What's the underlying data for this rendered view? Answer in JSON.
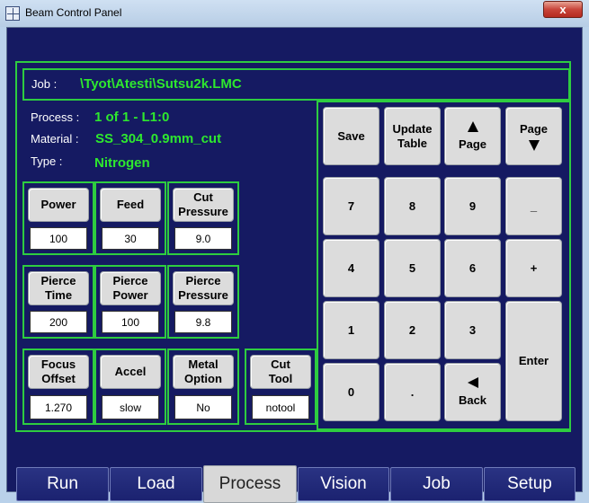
{
  "window": {
    "title": "Beam Control Panel",
    "close_glyph": "x"
  },
  "job": {
    "label": "Job :",
    "value": "\\Tyot\\Atesti\\Sutsu2k.LMC"
  },
  "info": {
    "process_label": "Process :",
    "process_value": "1 of 1 - L1:0",
    "material_label": "Material :",
    "material_value": "SS_304_0.9mm_cut",
    "type_label": "Type :",
    "type_value": "Nitrogen"
  },
  "params": {
    "power": {
      "label": "Power",
      "value": "100"
    },
    "feed": {
      "label": "Feed",
      "value": "30"
    },
    "cut_pressure": {
      "label_1": "Cut",
      "label_2": "Pressure",
      "value": "9.0"
    },
    "pierce_time": {
      "label_1": "Pierce",
      "label_2": "Time",
      "value": "200"
    },
    "pierce_power": {
      "label_1": "Pierce",
      "label_2": "Power",
      "value": "100"
    },
    "pierce_pressure": {
      "label_1": "Pierce",
      "label_2": "Pressure",
      "value": "9.8"
    },
    "focus_offset": {
      "label_1": "Focus",
      "label_2": "Offset",
      "value": "1.270"
    },
    "accel": {
      "label": "Accel",
      "value": "slow"
    },
    "metal_option": {
      "label_1": "Metal",
      "label_2": "Option",
      "value": "No"
    },
    "cut_tool": {
      "label_1": "Cut",
      "label_2": "Tool",
      "value": "notool"
    }
  },
  "keypad": {
    "save": "Save",
    "update_1": "Update",
    "update_2": "Table",
    "page_up": "Page",
    "page_down": "Page",
    "k7": "7",
    "k8": "8",
    "k9": "9",
    "minus": "_",
    "k4": "4",
    "k5": "5",
    "k6": "6",
    "plus": "+",
    "k1": "1",
    "k2": "2",
    "k3": "3",
    "enter": "Enter",
    "k0": "0",
    "dot": ".",
    "back": "Back"
  },
  "tabs": [
    {
      "label": "Run"
    },
    {
      "label": "Load"
    },
    {
      "label": "Process",
      "active": true
    },
    {
      "label": "Vision"
    },
    {
      "label": "Job"
    },
    {
      "label": "Setup"
    }
  ],
  "colors": {
    "panel_bg": "#151a62",
    "frame_green": "#2ecc40",
    "value_green": "#2ee82e",
    "button_gray": "#dcdcdc"
  }
}
